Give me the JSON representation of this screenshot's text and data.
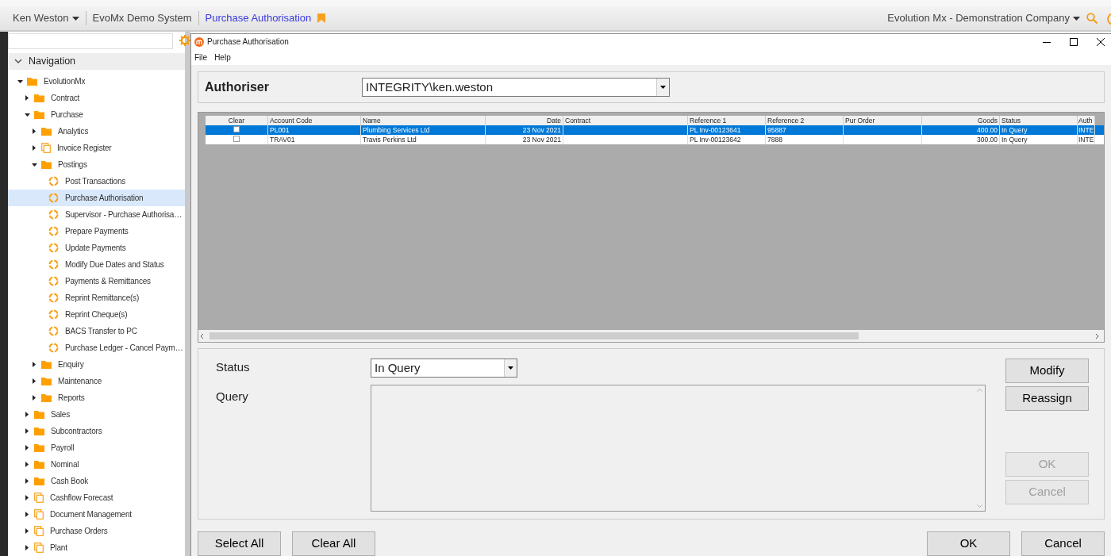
{
  "top_bar": {
    "user": "Ken Weston",
    "system": "EvoMx Demo System",
    "page": "Purchase Authorisation",
    "bookmarked": true,
    "company": "Evolution Mx - Demonstration Company"
  },
  "navigation": {
    "title": "Navigation",
    "expanded": true,
    "tree": [
      {
        "label": "EvolutionMx",
        "kind": "folder",
        "expanded": true,
        "selected": false,
        "children": [
          {
            "label": "Contract",
            "kind": "folder",
            "expanded": false,
            "selected": false
          },
          {
            "label": "Purchase",
            "kind": "folder",
            "expanded": true,
            "selected": false,
            "children": [
              {
                "label": "Analytics",
                "kind": "folder",
                "expanded": false,
                "selected": false
              },
              {
                "label": "Invoice Register",
                "kind": "document",
                "expanded": false,
                "selected": false
              },
              {
                "label": "Postings",
                "kind": "folder",
                "expanded": true,
                "selected": false,
                "children": [
                  {
                    "label": "Post Transactions",
                    "kind": "process",
                    "selected": false
                  },
                  {
                    "label": "Purchase Authorisation",
                    "kind": "process",
                    "selected": true
                  },
                  {
                    "label": "Supervisor - Purchase Authorisa…",
                    "kind": "process",
                    "selected": false
                  },
                  {
                    "label": "Prepare Payments",
                    "kind": "process",
                    "selected": false
                  },
                  {
                    "label": "Update Payments",
                    "kind": "process",
                    "selected": false
                  },
                  {
                    "label": "Modify Due Dates and Status",
                    "kind": "process",
                    "selected": false
                  },
                  {
                    "label": "Payments & Remittances",
                    "kind": "process",
                    "selected": false
                  },
                  {
                    "label": "Reprint Remittance(s)",
                    "kind": "process",
                    "selected": false
                  },
                  {
                    "label": "Reprint Cheque(s)",
                    "kind": "process",
                    "selected": false
                  },
                  {
                    "label": "BACS Transfer to PC",
                    "kind": "process",
                    "selected": false
                  },
                  {
                    "label": "Purchase Ledger - Cancel Paym…",
                    "kind": "process",
                    "selected": false
                  }
                ]
              },
              {
                "label": "Enquiry",
                "kind": "folder",
                "expanded": false,
                "selected": false
              },
              {
                "label": "Maintenance",
                "kind": "folder",
                "expanded": false,
                "selected": false
              },
              {
                "label": "Reports",
                "kind": "folder",
                "expanded": false,
                "selected": false
              }
            ]
          },
          {
            "label": "Sales",
            "kind": "folder",
            "expanded": false,
            "selected": false
          },
          {
            "label": "Subcontractors",
            "kind": "folder",
            "expanded": false,
            "selected": false
          },
          {
            "label": "Payroll",
            "kind": "folder",
            "expanded": false,
            "selected": false
          },
          {
            "label": "Nominal",
            "kind": "folder",
            "expanded": false,
            "selected": false
          },
          {
            "label": "Cash Book",
            "kind": "folder",
            "expanded": false,
            "selected": false
          },
          {
            "label": "Cashflow Forecast",
            "kind": "document",
            "expanded": false,
            "selected": false
          },
          {
            "label": "Document Management",
            "kind": "document",
            "expanded": false,
            "selected": false
          },
          {
            "label": "Purchase Orders",
            "kind": "document",
            "expanded": false,
            "selected": false
          },
          {
            "label": "Plant",
            "kind": "document",
            "expanded": false,
            "selected": false
          }
        ]
      }
    ]
  },
  "dialog": {
    "title": "Purchase Authorisation",
    "menu": [
      "File",
      "Help"
    ],
    "authoriser": {
      "label": "Authoriser",
      "value": "INTEGRITY\\ken.weston"
    },
    "table": {
      "columns": [
        {
          "label": "Clear",
          "kind": "check"
        },
        {
          "label": "Account Code",
          "kind": "text"
        },
        {
          "label": "Name",
          "kind": "text"
        },
        {
          "label": "Date",
          "kind": "date"
        },
        {
          "label": "Contract",
          "kind": "text"
        },
        {
          "label": "Reference 1",
          "kind": "text"
        },
        {
          "label": "Reference 2",
          "kind": "text"
        },
        {
          "label": "Pur Order",
          "kind": "text"
        },
        {
          "label": "Goods",
          "kind": "amount"
        },
        {
          "label": "Status",
          "kind": "text"
        },
        {
          "label": "Auth",
          "kind": "text"
        }
      ],
      "rows": [
        {
          "selected": true,
          "checked": false,
          "cells": [
            "",
            "PL001",
            "Plumbing Services Ltd",
            "23 Nov 2021",
            "",
            "PL Inv-00123641",
            "95887",
            "",
            "400.00",
            "In Query",
            "INTE"
          ]
        },
        {
          "selected": false,
          "checked": false,
          "cells": [
            "",
            "TRAV01",
            "Travis Perkins Ltd",
            "23 Nov 2021",
            "",
            "PL Inv-00123642",
            "7888",
            "",
            "300.00",
            "In Query",
            "INTE"
          ]
        }
      ]
    },
    "status": {
      "label": "Status",
      "value": "In Query"
    },
    "query": {
      "label": "Query"
    },
    "side_buttons": [
      {
        "label": "Modify",
        "disabled": false
      },
      {
        "label": "Reassign",
        "disabled": false
      },
      {
        "label": "OK",
        "disabled": true
      },
      {
        "label": "Cancel",
        "disabled": true
      }
    ],
    "left_buttons": [
      {
        "label": "Select All",
        "disabled": false
      },
      {
        "label": "Clear All",
        "disabled": false
      }
    ],
    "right_buttons": [
      {
        "label": "OK",
        "disabled": false
      },
      {
        "label": "Cancel",
        "disabled": false
      }
    ]
  }
}
